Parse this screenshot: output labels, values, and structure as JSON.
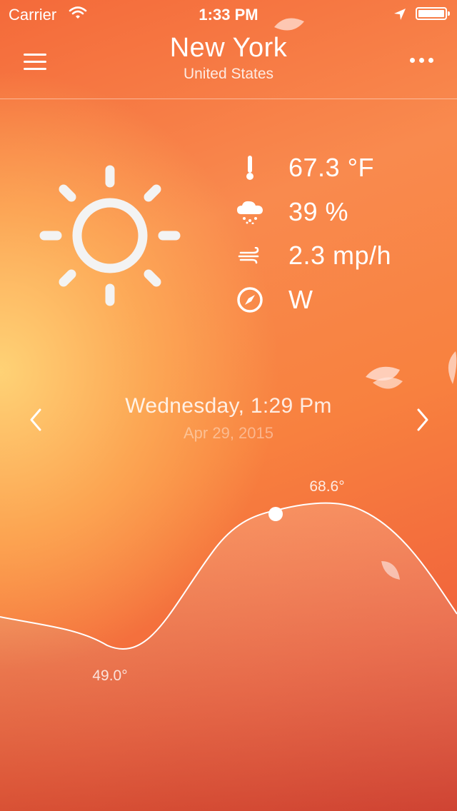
{
  "status_bar": {
    "carrier": "Carrier",
    "time": "1:33 PM",
    "icons": [
      "wifi-icon",
      "location-arrow-icon",
      "battery-icon"
    ]
  },
  "header": {
    "city": "New York",
    "country": "United States",
    "icons": [
      "menu-icon",
      "more-icon"
    ]
  },
  "conditions": {
    "weather_icon": "sun-icon",
    "items": [
      {
        "icon": "thermometer-icon",
        "value": "67.3 °F"
      },
      {
        "icon": "rain-cloud-icon",
        "value": "39 %"
      },
      {
        "icon": "wind-icon",
        "value": "2.3 mp/h"
      },
      {
        "icon": "compass-icon",
        "value": "W"
      }
    ]
  },
  "date_nav": {
    "title": "Wednesday, 1:29 Pm",
    "subtitle": "Apr 29, 2015",
    "icons": [
      "chevron-left-icon",
      "chevron-right-icon"
    ]
  },
  "chart_data": {
    "type": "area",
    "labels": {
      "max": "68.6°",
      "min": "49.0°"
    },
    "max": 68.6,
    "min": 49.0,
    "line_color": "#ffffff"
  },
  "colors": {
    "gradient_top": "#f46a3a",
    "gradient_glow": "#ffd678",
    "gradient_bottom": "#e2503a",
    "text": "#ffffff"
  }
}
